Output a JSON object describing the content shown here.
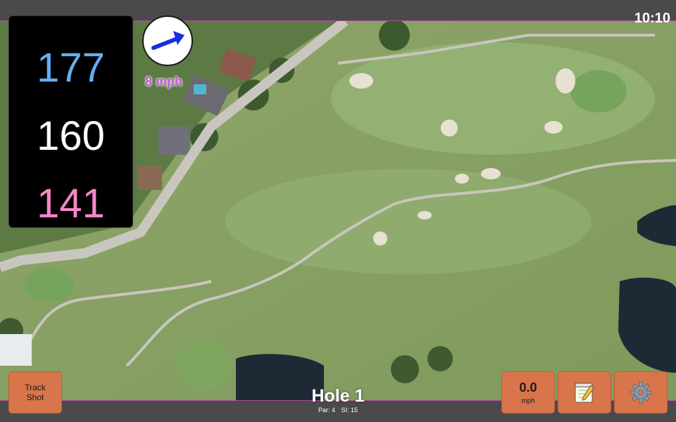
{
  "status_bar": {
    "time": "10:10"
  },
  "yardage": {
    "back": "177",
    "center": "160",
    "front": "141"
  },
  "wind": {
    "speed_label": "8 mph",
    "direction_icon": "arrow-icon"
  },
  "hole": {
    "title": "Hole 1",
    "par": "Par: 4",
    "si": "SI: 15"
  },
  "buttons": {
    "track_line1": "Track",
    "track_line2": "Shot",
    "speed_value": "0.0",
    "speed_unit": "mph",
    "notes_icon": "notepad-icon",
    "settings_icon": "gear-icon"
  },
  "colors": {
    "back_yardage": "#64aef2",
    "center_yardage": "#ffffff",
    "front_yardage": "#f587c8",
    "button": "#d9754a",
    "wind_arrow": "#1a2ee0",
    "wind_label": "#c05bd4"
  }
}
